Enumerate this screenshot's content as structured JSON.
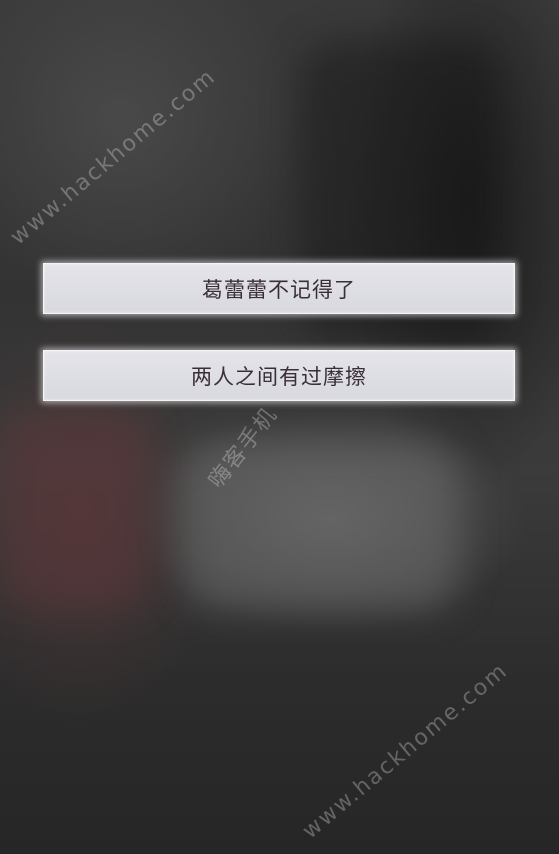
{
  "choices": [
    {
      "label": "葛蕾蕾不记得了"
    },
    {
      "label": "两人之间有过摩擦"
    }
  ],
  "watermarks": [
    {
      "text": "www.hackhome.com"
    },
    {
      "text": "嗨客手机"
    },
    {
      "text": "www.hackhome.com"
    }
  ]
}
